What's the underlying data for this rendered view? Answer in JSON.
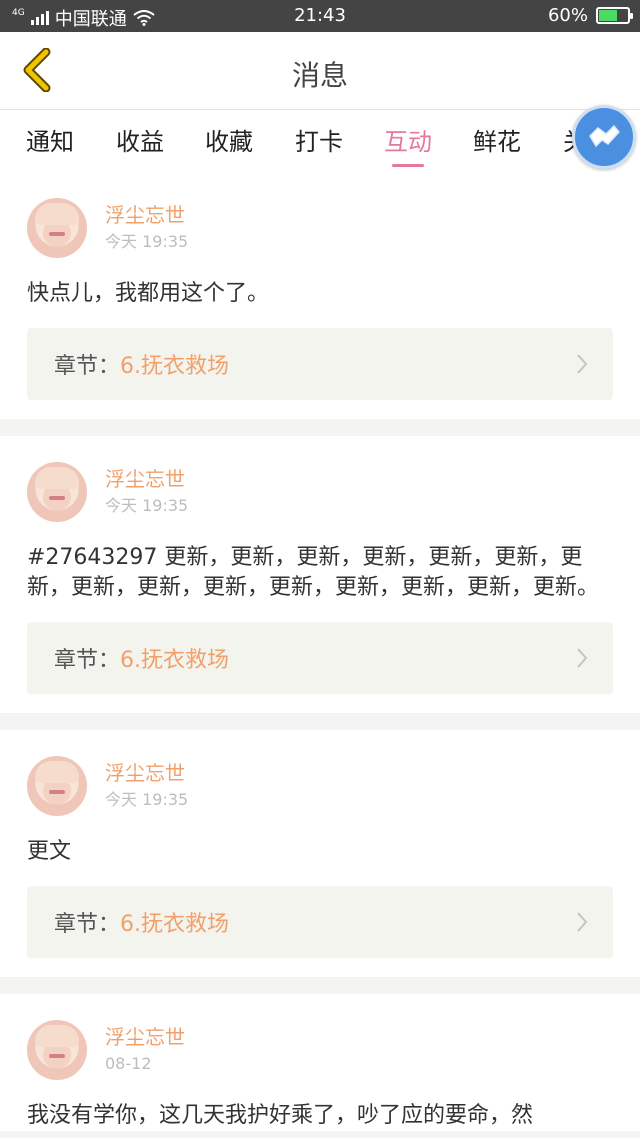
{
  "status_bar": {
    "network": "4G",
    "carrier": "中国联通",
    "time": "21:43",
    "battery": "60%",
    "battery_level": 0.6
  },
  "header": {
    "title": "消息"
  },
  "tabs": [
    {
      "label": "通知",
      "active": false
    },
    {
      "label": "收益",
      "active": false
    },
    {
      "label": "收藏",
      "active": false
    },
    {
      "label": "打卡",
      "active": false
    },
    {
      "label": "互动",
      "active": true
    },
    {
      "label": "鲜花",
      "active": false
    },
    {
      "label": "关注",
      "active": false
    }
  ],
  "colors": {
    "accent_tab": "#e4789f",
    "name": "#f0a16b",
    "chapter_value": "#f0a16b",
    "back_icon": "#f2c400",
    "float_button": "#4a8fe0"
  },
  "messages": [
    {
      "user": "浮尘忘世",
      "time": "今天 19:35",
      "text": "快点儿，我都用这个了。",
      "chapter_label": "章节：",
      "chapter": "6.抚衣救场"
    },
    {
      "user": "浮尘忘世",
      "time": "今天 19:35",
      "text": "#27643297 更新，更新，更新，更新，更新，更新，更新，更新，更新，更新，更新，更新，更新，更新，更新。",
      "chapter_label": "章节：",
      "chapter": "6.抚衣救场"
    },
    {
      "user": "浮尘忘世",
      "time": "今天 19:35",
      "text": "更文",
      "chapter_label": "章节：",
      "chapter": "6.抚衣救场"
    },
    {
      "user": "浮尘忘世",
      "time": "08-12",
      "text": "我没有学你，这几天我护好乘了，吵了应的要命，然",
      "chapter_label": "",
      "chapter": ""
    }
  ]
}
